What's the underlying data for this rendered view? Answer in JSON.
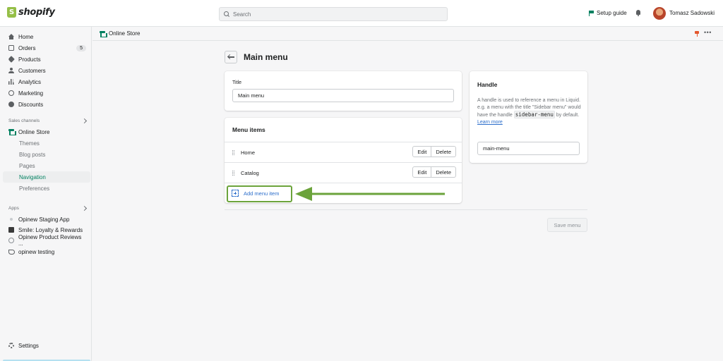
{
  "topbar": {
    "brand": "shopify",
    "search_placeholder": "Search",
    "setup_guide": "Setup guide",
    "user_name": "Tomasz Sadowski"
  },
  "sidebar": {
    "main_items": [
      {
        "label": "Home",
        "icon": "home-icon"
      },
      {
        "label": "Orders",
        "icon": "orders-icon",
        "badge": "5"
      },
      {
        "label": "Products",
        "icon": "products-icon"
      },
      {
        "label": "Customers",
        "icon": "customers-icon"
      },
      {
        "label": "Analytics",
        "icon": "analytics-icon"
      },
      {
        "label": "Marketing",
        "icon": "marketing-icon"
      },
      {
        "label": "Discounts",
        "icon": "discounts-icon"
      }
    ],
    "sales_channels_label": "Sales channels",
    "online_store": "Online Store",
    "store_subitems": [
      "Themes",
      "Blog posts",
      "Pages",
      "Navigation",
      "Preferences"
    ],
    "apps_label": "Apps",
    "apps": [
      "Opinew Staging App",
      "Smile: Loyalty & Rewards",
      "Opinew Product Reviews ...",
      "opinew testing"
    ],
    "settings": "Settings"
  },
  "breadcrumb": {
    "label": "Online Store",
    "more": "•••"
  },
  "main": {
    "title": "Main menu",
    "title_card": {
      "label": "Title",
      "value": "Main menu"
    },
    "menu_card": {
      "heading": "Menu items",
      "items": [
        {
          "label": "Home",
          "edit": "Edit",
          "delete": "Delete"
        },
        {
          "label": "Catalog",
          "edit": "Edit",
          "delete": "Delete"
        }
      ],
      "add_label": "Add menu item"
    },
    "handle_card": {
      "heading": "Handle",
      "desc_1": "A handle is used to reference a menu in Liquid. e.g. a menu with the title \"Sidebar menu\" would have the handle ",
      "code": "sidebar-menu",
      "desc_2": " by default. ",
      "learn_more": "Learn more",
      "value": "main-menu"
    },
    "save_label": "Save menu"
  },
  "colors": {
    "accent_green": "#008060",
    "annotation_green": "#6ba33b",
    "link_blue": "#2c6ecb"
  }
}
